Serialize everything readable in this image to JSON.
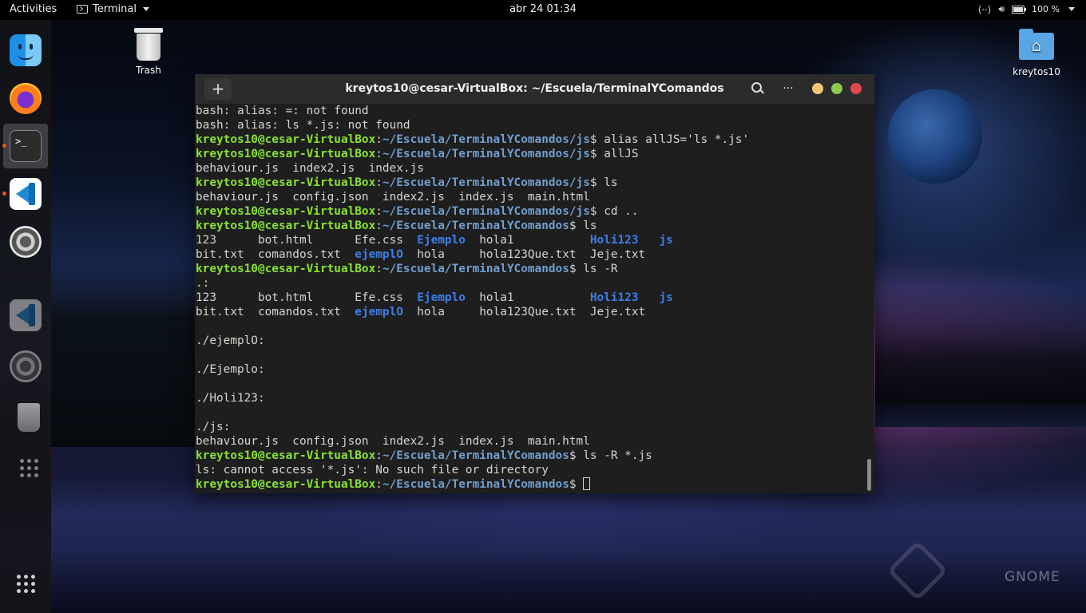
{
  "topbar": {
    "activities": "Activities",
    "app_name": "Terminal",
    "clock": "abr 24  01:34",
    "battery": "100 %"
  },
  "desktop": {
    "trash_label": "Trash",
    "home_label": "kreytos10",
    "watermark": "GNOME"
  },
  "dock": {
    "items": [
      "finder-icon",
      "firefox-icon",
      "terminal-icon",
      "vscode-icon",
      "settings-icon",
      "trash-icon",
      "app-grid-icon"
    ]
  },
  "terminal": {
    "title": "kreytos10@cesar-VirtualBox: ~/Escuela/TerminalYComandos",
    "new_tab": "+",
    "menu": "···",
    "user_host": "kreytos10@cesar-VirtualBox",
    "path_js": "~/Escuela/TerminalYComandos/js",
    "path_root": "~/Escuela/TerminalYComandos",
    "lines": {
      "l1": "bash: alias: =: not found",
      "l2": "bash: alias: ls *.js: not found",
      "cmd_alias": "alias allJS='ls *.js'",
      "cmd_alljs": "allJS",
      "out_alljs": "behaviour.js  index2.js  index.js",
      "cmd_ls": "ls",
      "out_ls_js": "behaviour.js  config.json  index2.js  index.js  main.html",
      "cmd_cd": "cd ..",
      "cmd_ls2": "ls",
      "grid1_a": "123      bot.html      Efe.css  ",
      "grid1_dir1": "Ejemplo",
      "grid1_b": "  hola1           ",
      "grid1_dir2": "Holi123",
      "grid1_c": "   ",
      "grid1_dir3": "js",
      "grid2_a": "bit.txt  comandos.txt  ",
      "grid2_dir1": "ejemplO",
      "grid2_b": "  hola     hola123Que.txt  Jeje.txt",
      "cmd_lsR": "ls -R",
      "dot": ".:",
      "sec_ejemplo0": "./ejemplO:",
      "sec_ejemplo": "./Ejemplo:",
      "sec_holi": "./Holi123:",
      "sec_js": "./js:",
      "out_js": "behaviour.js  config.json  index2.js  index.js  main.html",
      "cmd_lsRjs": "ls -R *.js",
      "err": "ls: cannot access '*.js': No such file or directory"
    }
  },
  "colors": {
    "prompt_user": "#8ae234",
    "prompt_path": "#729fcf",
    "directory": "#3d7ee8",
    "terminal_bg": "#1e1e1e",
    "close": "#e0484b",
    "maximize": "#8bc94f",
    "minimize": "#f0c674"
  }
}
